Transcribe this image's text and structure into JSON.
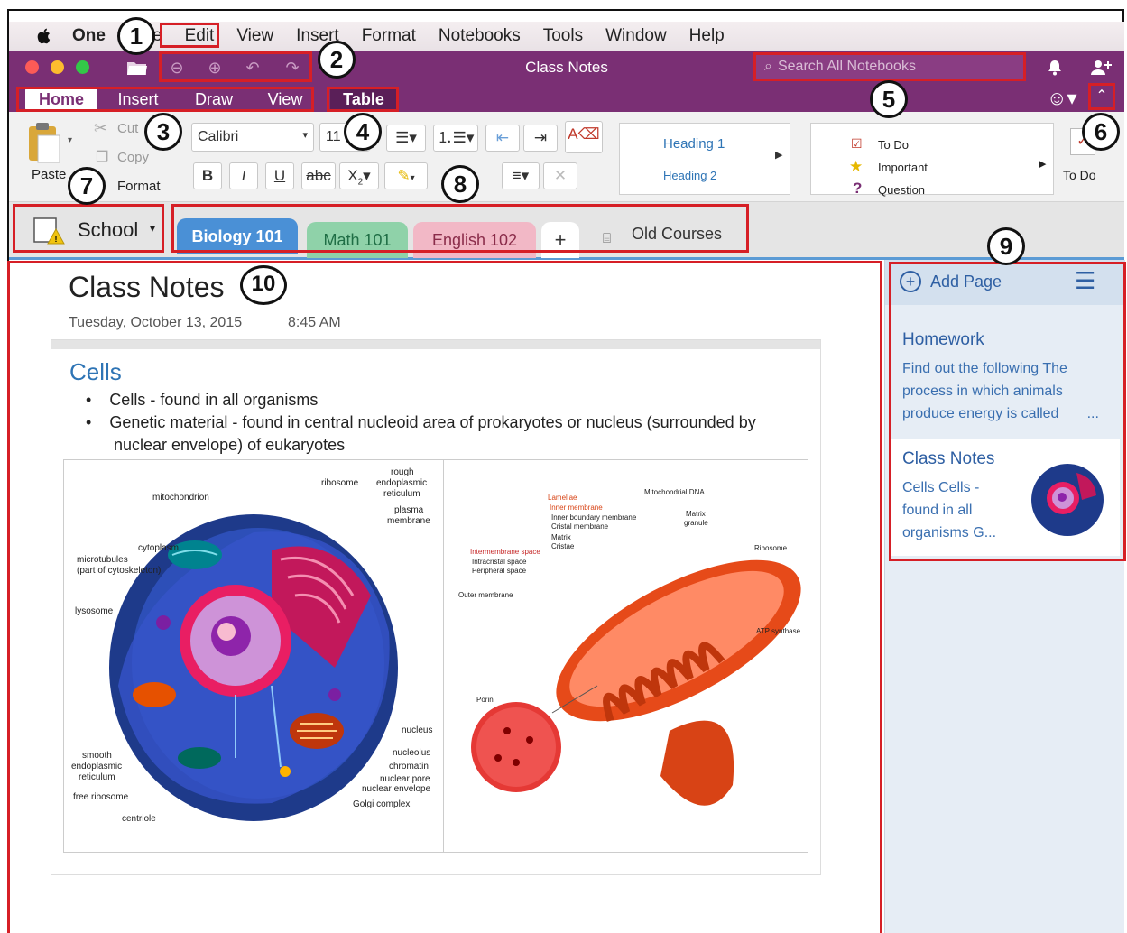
{
  "menubar": {
    "app_name": "One",
    "items": [
      "File",
      "Edit",
      "View",
      "Insert",
      "Format",
      "Notebooks",
      "Tools",
      "Window",
      "Help"
    ]
  },
  "titlebar": {
    "title": "Class Notes",
    "search_placeholder": "Search All Notebooks"
  },
  "ribbon_tabs": [
    "Home",
    "Insert",
    "Draw",
    "View",
    "Table"
  ],
  "ribbon": {
    "paste_label": "Paste",
    "cut_label": "Cut",
    "copy_label": "Copy",
    "format_label": "Format",
    "font_name": "Calibri",
    "font_size": "11",
    "bold": "B",
    "italic": "I",
    "underline": "U",
    "strike": "abc",
    "subscript": "X",
    "styles": [
      "Heading 1",
      "Heading 2"
    ],
    "tags": [
      "To Do",
      "Important",
      "Question"
    ],
    "todo_label": "To Do"
  },
  "notebook": {
    "name": "School",
    "sections": [
      "Biology 101",
      "Math 101",
      "English 102"
    ],
    "add_label": "+",
    "old_courses": "Old Courses"
  },
  "page": {
    "title": "Class Notes",
    "date": "Tuesday, October 13, 2015",
    "time": "8:45 AM",
    "heading": "Cells",
    "bullets": [
      "Cells - found in all organisms",
      "Genetic material - found in central nucleoid area of prokaryotes or nucleus (surrounded by",
      "nuclear envelope) of eukaryotes"
    ],
    "cell_labels": [
      "mitochondrion",
      "ribosome",
      "rough",
      "endoplasmic",
      "reticulum",
      "plasma",
      "membrane",
      "cytoplasm",
      "microtubules",
      "(part of cytoskeleton)",
      "lysosome",
      "nucleus",
      "nucleolus",
      "chromatin",
      "nuclear pore",
      "nuclear envelope",
      "smooth",
      "endoplasmic",
      "reticulum",
      "free ribosome",
      "Golgi complex",
      "centriole"
    ],
    "mito_labels": [
      "Lamellae",
      "Inner membrane",
      "Inner boundary membrane",
      "Cristal membrane",
      "Matrix",
      "Cristae",
      "Intermembrane space",
      "Intracristal space",
      "Peripheral space",
      "Outer membrane",
      "Mitochondrial DNA",
      "Matrix",
      "granule",
      "Ribosome",
      "ATP synthase",
      "Porin"
    ]
  },
  "sidebar": {
    "add_page": "Add Page",
    "pages": [
      {
        "title": "Homework",
        "preview": [
          "Find out the following  The",
          "process in which animals",
          "produce energy is called ___..."
        ]
      },
      {
        "title": "Class Notes",
        "preview": [
          "Cells  Cells -",
          "found in all",
          "organisms  G..."
        ]
      }
    ]
  },
  "callouts": [
    "1",
    "2",
    "3",
    "4",
    "5",
    "6",
    "7",
    "8",
    "9",
    "10"
  ],
  "colors": {
    "purple": "#7a2f74",
    "annotation_red": "#d61f26",
    "tab_biology": "#4a90d6",
    "tab_math": "#8fd2a9",
    "tab_english": "#f2b8c6"
  }
}
